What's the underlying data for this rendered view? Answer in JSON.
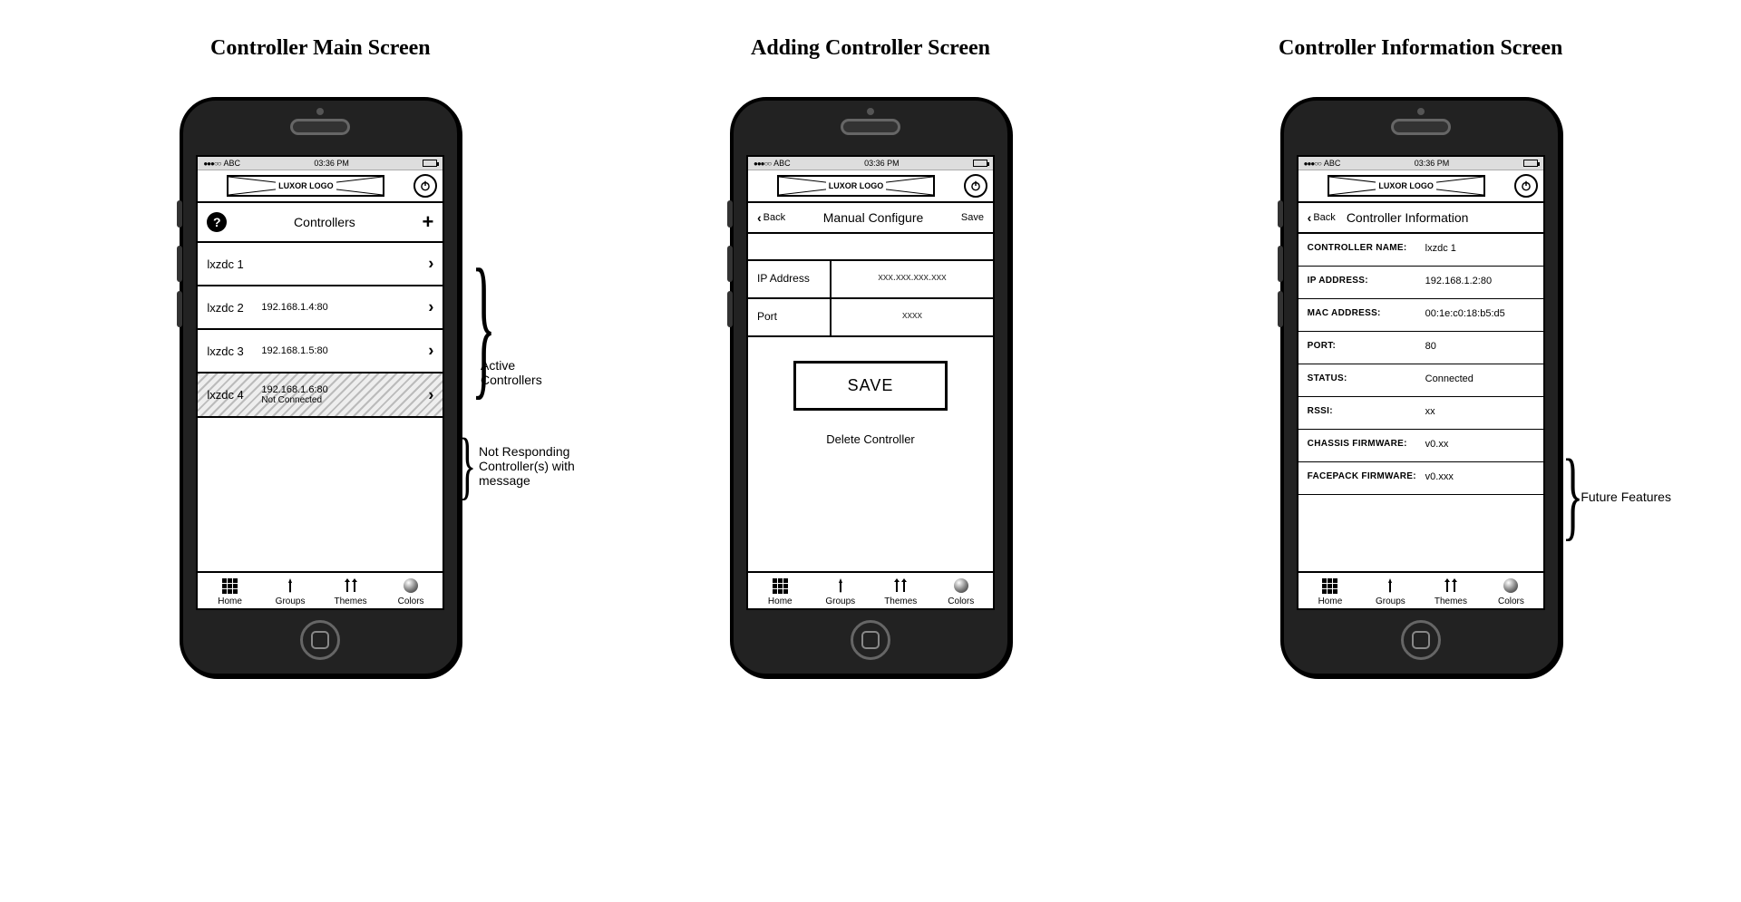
{
  "captions": {
    "main": "Controller Main Screen",
    "adding": "Adding Controller Screen",
    "info": "Controller Information Screen"
  },
  "statusbar": {
    "carrier": "ABC",
    "time": "03:36 PM"
  },
  "logo_text": "LUXOR LOGO",
  "screen_main": {
    "title": "Controllers",
    "items": [
      {
        "name": "lxzdc 1",
        "ip": ""
      },
      {
        "name": "lxzdc 2",
        "ip": "192.168.1.4:80"
      },
      {
        "name": "lxzdc 3",
        "ip": "192.168.1.5:80"
      },
      {
        "name": "lxzdc 4",
        "ip": "192.168.1.6:80",
        "status": "Not Connected"
      }
    ]
  },
  "screen_adding": {
    "back": "Back",
    "title": "Manual Configure",
    "save_link": "Save",
    "ip_label": "IP Address",
    "ip_placeholder": "xxx.xxx.xxx.xxx",
    "port_label": "Port",
    "port_placeholder": "xxxx",
    "save_button": "SAVE",
    "delete": "Delete Controller"
  },
  "screen_info": {
    "back": "Back",
    "title": "Controller Information",
    "rows": {
      "controller_name_label": "CONTROLLER NAME:",
      "controller_name_value": "lxzdc 1",
      "ip_label": "IP ADDRESS:",
      "ip_value": "192.168.1.2:80",
      "mac_label": "MAC ADDRESS:",
      "mac_value": "00:1e:c0:18:b5:d5",
      "port_label": "PORT:",
      "port_value": "80",
      "status_label": "STATUS:",
      "status_value": "Connected",
      "rssi_label": "RSSI:",
      "rssi_value": "xx",
      "chassis_label": "CHASSIS FIRMWARE:",
      "chassis_value": "v0.xx",
      "facepack_label": "FACEPACK FIRMWARE:",
      "facepack_value": "v0.xxx"
    }
  },
  "tabs": {
    "home": "Home",
    "groups": "Groups",
    "themes": "Themes",
    "colors": "Colors"
  },
  "annotations": {
    "active": "Active\nControllers",
    "not_responding": "Not Responding\nController(s) with\nmessage",
    "future": "Future Features"
  }
}
